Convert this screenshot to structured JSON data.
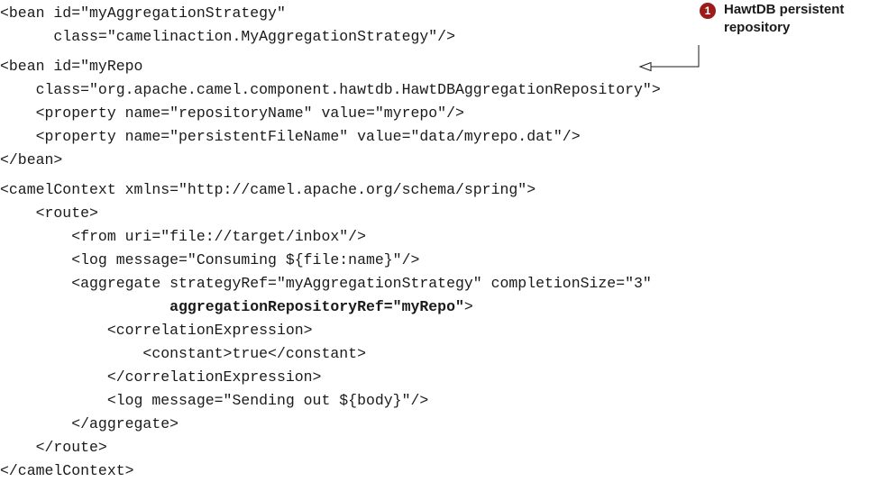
{
  "code_lines": [
    {
      "text": "<bean id=\"myAggregationStrategy\""
    },
    {
      "text": "      class=\"camelinaction.MyAggregationStrategy\"/>"
    },
    {
      "text": "<bean id=\"myRepo"
    },
    {
      "text": "    class=\"org.apache.camel.component.hawtdb.HawtDBAggregationRepository\">"
    },
    {
      "text": "    <property name=\"repositoryName\" value=\"myrepo\"/>"
    },
    {
      "text": "    <property name=\"persistentFileName\" value=\"data/myrepo.dat\"/>"
    },
    {
      "text": "</bean>"
    },
    {
      "text": "<camelContext xmlns=\"http://camel.apache.org/schema/spring\">"
    },
    {
      "text": "    <route>"
    },
    {
      "text": "        <from uri=\"file://target/inbox\"/>"
    },
    {
      "text": "        <log message=\"Consuming ${file:name}\"/>"
    },
    {
      "text": "        <aggregate strategyRef=\"myAggregationStrategy\" completionSize=\"3\""
    },
    {
      "text": "                   aggregationRepositoryRef=\"myRepo\"",
      "suffix": ">"
    },
    {
      "text": "            <correlationExpression>"
    },
    {
      "text": "                <constant>true</constant>"
    },
    {
      "text": "            </correlationExpression>"
    },
    {
      "text": "            <log message=\"Sending out ${body}\"/>"
    },
    {
      "text": "        </aggregate>"
    },
    {
      "text": "    </route>"
    },
    {
      "text": "</camelContext>"
    }
  ],
  "annotation": {
    "number": "1",
    "text": "HawtDB persistent\nrepository",
    "accent_color": "#9b1b1b"
  }
}
